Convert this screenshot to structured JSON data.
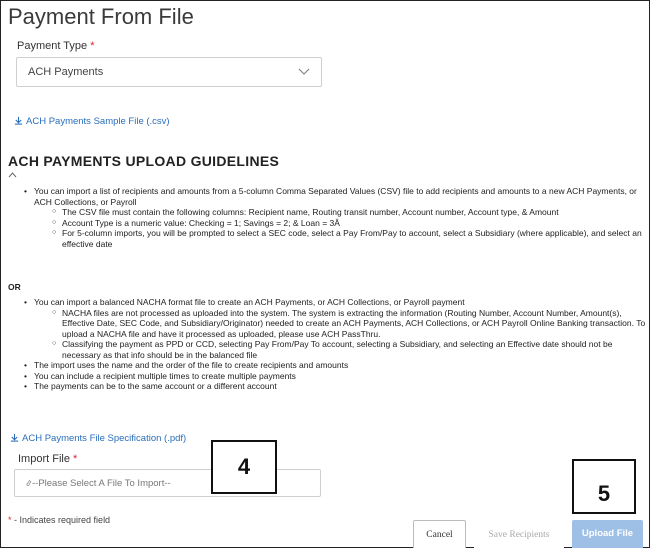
{
  "page": {
    "title": "Payment From File"
  },
  "payment_type": {
    "label": "Payment Type",
    "required_mark": "*",
    "selected": "ACH Payments"
  },
  "sample_link": {
    "label": "ACH Payments Sample File (.csv)"
  },
  "guidelines": {
    "heading": "ACH PAYMENTS UPLOAD GUIDELINES",
    "section1": {
      "item1": "You can import a list of recipients and amounts from a 5-column Comma Separated Values (CSV) file to add recipients and amounts to a new ACH Payments, or ACH Collections, or Payroll",
      "sub1": "The CSV file must contain the following columns: Recipient name, Routing transit number, Account number, Account type, & Amount",
      "sub2": "Account Type is a numeric value: Checking = 1; Savings = 2; & Loan = 3Â",
      "sub3": "For 5-column imports, you will be prompted to select a SEC code, select a Pay From/Pay to account, select a Subsidiary (where applicable), and select an effective date"
    },
    "or_label": "OR",
    "section2": {
      "item1": "You can import a balanced NACHA format file to create an ACH Payments, or ACH Collections, or Payroll payment",
      "sub1": "NACHA files are not processed as uploaded into the system. The system is extracting the information (Routing Number, Account Number, Amount(s), Effective Date, SEC Code, and Subsidiary/Originator) needed to create an ACH Payments, ACH Collections, or ACH Payroll Online Banking transaction. To upload a NACHA file and have it processed as uploaded, please use ACH PassThru.",
      "sub2": "Classifying the payment as PPD or CCD, selecting Pay From/Pay To account, selecting a Subsidiary, and selecting an Effective date should not be necessary as that info should be in the balanced file",
      "item2": "The import uses the name and the order of the file to create recipients and amounts",
      "item3": "You can include a recipient multiple times to create multiple payments",
      "item4": "The payments can be to the same account or a different account"
    }
  },
  "spec_link": {
    "label": "ACH Payments File Specification (.pdf)"
  },
  "import_file": {
    "label": "Import File",
    "required_mark": "*",
    "placeholder": "--Please Select A File To Import--"
  },
  "callouts": {
    "first": "4",
    "second": "5"
  },
  "footer": {
    "required_note": "* - Indicates required field",
    "cancel_label": "Cancel",
    "save_label": "Save Recipients",
    "upload_label": "Upload File"
  },
  "colors": {
    "link": "#2a6ebb",
    "required": "#d8272d",
    "upload_button": "#9fc0e6"
  }
}
